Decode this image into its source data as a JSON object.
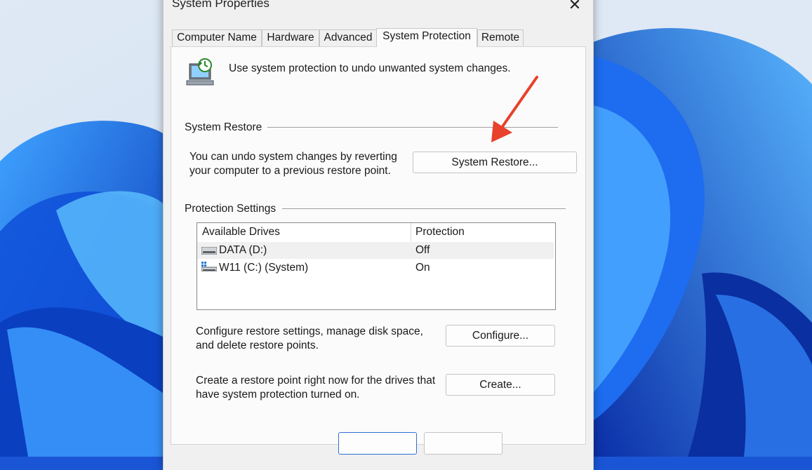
{
  "window": {
    "title": "System Properties",
    "close_glyph": "✕"
  },
  "tabs": [
    {
      "label": "Computer Name",
      "active": false
    },
    {
      "label": "Hardware",
      "active": false
    },
    {
      "label": "Advanced",
      "active": false
    },
    {
      "label": "System Protection",
      "active": true
    },
    {
      "label": "Remote",
      "active": false
    }
  ],
  "intro": {
    "text": "Use system protection to undo unwanted system changes."
  },
  "system_restore": {
    "group_label": "System Restore",
    "desc_line1": "You can undo system changes by reverting",
    "desc_line2": "your computer to a previous restore point.",
    "button_label": "System Restore..."
  },
  "protection": {
    "group_label": "Protection Settings",
    "columns": [
      "Available Drives",
      "Protection"
    ],
    "drives": [
      {
        "name": "DATA (D:)",
        "protection": "Off",
        "icon": "drive-icon"
      },
      {
        "name": "W11 (C:) (System)",
        "protection": "On",
        "icon": "windows-drive-icon"
      }
    ],
    "configure_line1": "Configure restore settings, manage disk space,",
    "configure_line2": "and delete restore points.",
    "configure_button": "Configure...",
    "create_line1": "Create a restore point right now for the drives that",
    "create_line2": "have system protection turned on.",
    "create_button": "Create..."
  },
  "annotation": {
    "arrow_color": "#e8412c"
  },
  "colors": {
    "wallpaper_blue": "#1a55d6",
    "dialog_bg": "#f0f0f0"
  }
}
